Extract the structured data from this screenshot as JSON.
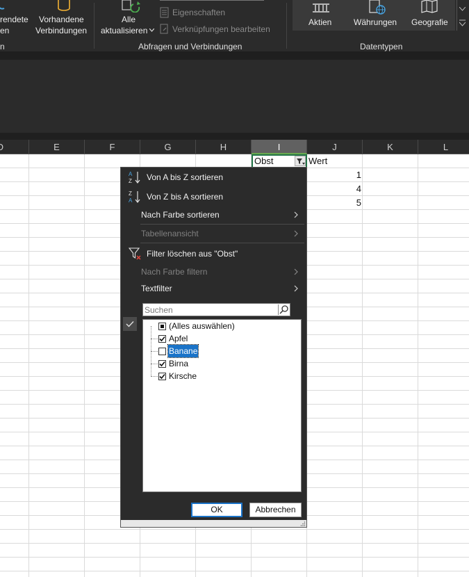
{
  "ribbon": {
    "partial_left_top": "rendete",
    "partial_left_bottom": "en",
    "vorhandene_line1": "Vorhandene",
    "vorhandene_line2": "Verbindungen",
    "alle_line1": "Alle",
    "alle_line2": "aktualisieren",
    "eigenschaften": "Eigenschaften",
    "verknuepfungen": "Verknüpfungen bearbeiten",
    "partial_left_group": "n",
    "group_abfragen": "Abfragen und Verbindungen",
    "group_datentypen": "Datentypen",
    "aktien": "Aktien",
    "waehrungen": "Währungen",
    "geografie": "Geografie"
  },
  "columns": [
    "D",
    "E",
    "F",
    "G",
    "H",
    "I",
    "J",
    "K",
    "L"
  ],
  "cells": {
    "i1": "Obst",
    "j1": "Wert",
    "j2": "1",
    "j3": "4",
    "j4": "5"
  },
  "menu": {
    "sort_az": "Von A bis Z sortieren",
    "sort_za": "Von Z bis A sortieren",
    "sort_color": "Nach Farbe sortieren",
    "table_view": "Tabellenansicht",
    "clear_filter": "Filter löschen aus \"Obst\"",
    "filter_color": "Nach Farbe filtern",
    "text_filter": "Textfilter",
    "search_placeholder": "Suchen",
    "items": [
      {
        "label": "(Alles auswählen)",
        "state": "partial"
      },
      {
        "label": "Apfel",
        "state": "checked"
      },
      {
        "label": "Banane",
        "state": "unchecked"
      },
      {
        "label": "Birna",
        "state": "checked"
      },
      {
        "label": "Kirsche",
        "state": "checked"
      }
    ],
    "ok": "OK",
    "cancel": "Abbrechen"
  }
}
